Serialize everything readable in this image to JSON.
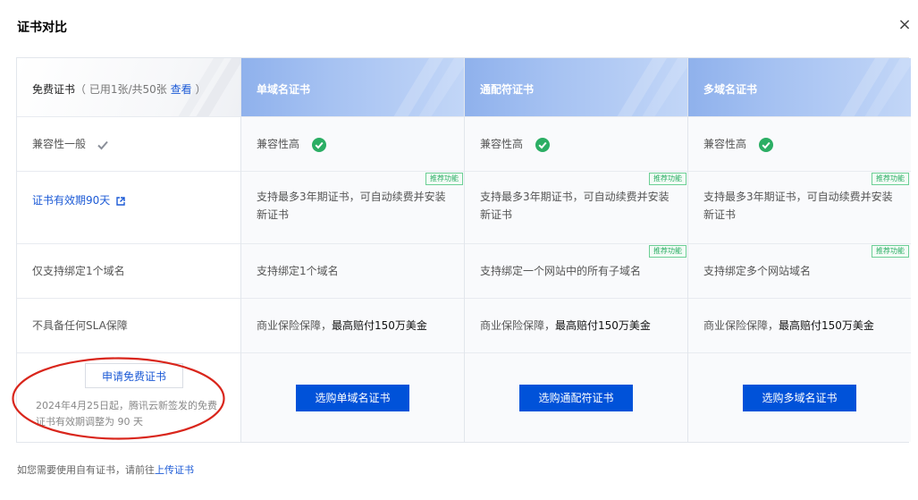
{
  "dialog": {
    "title": "证书对比",
    "close_label": "×"
  },
  "free": {
    "name": "免费证书",
    "usage_prefix": "（ 已用1张/共50张",
    "view_link": "查看",
    "usage_suffix": " ）",
    "compat": "兼容性一般",
    "validity": "证书有效期90天",
    "domain": "仅支持绑定1个域名",
    "sla": "不具备任何SLA保障",
    "apply_button": "申请免费证书",
    "note": "2024年4月25日起，腾讯云新签发的免费证书有效期调整为 90 天"
  },
  "paid": [
    {
      "name": "单域名证书",
      "compat": "兼容性高",
      "renew": "支持最多3年期证书，可自动续费并安装新证书",
      "renew_badge": "推荐功能",
      "domain": "支持绑定1个域名",
      "domain_badge": "",
      "insurance_prefix": "商业保险保障，",
      "insurance_strong": "最高赔付150万美金",
      "buy_button": "选购单域名证书"
    },
    {
      "name": "通配符证书",
      "compat": "兼容性高",
      "renew": "支持最多3年期证书，可自动续费并安装新证书",
      "renew_badge": "推荐功能",
      "domain": "支持绑定一个网站中的所有子域名",
      "domain_badge": "推荐功能",
      "insurance_prefix": "商业保险保障，",
      "insurance_strong": "最高赔付150万美金",
      "buy_button": "选购通配符证书"
    },
    {
      "name": "多域名证书",
      "compat": "兼容性高",
      "renew": "支持最多3年期证书，可自动续费并安装新证书",
      "renew_badge": "推荐功能",
      "domain": "支持绑定多个网站域名",
      "domain_badge": "推荐功能",
      "insurance_prefix": "商业保险保障，",
      "insurance_strong": "最高赔付150万美金",
      "buy_button": "选购多域名证书"
    }
  ],
  "footer": {
    "text": "如您需要使用自有证书，请前往",
    "link": "上传证书"
  },
  "colors": {
    "primary": "#0052d9",
    "success": "#2bae64",
    "annotation": "#d9261c"
  }
}
